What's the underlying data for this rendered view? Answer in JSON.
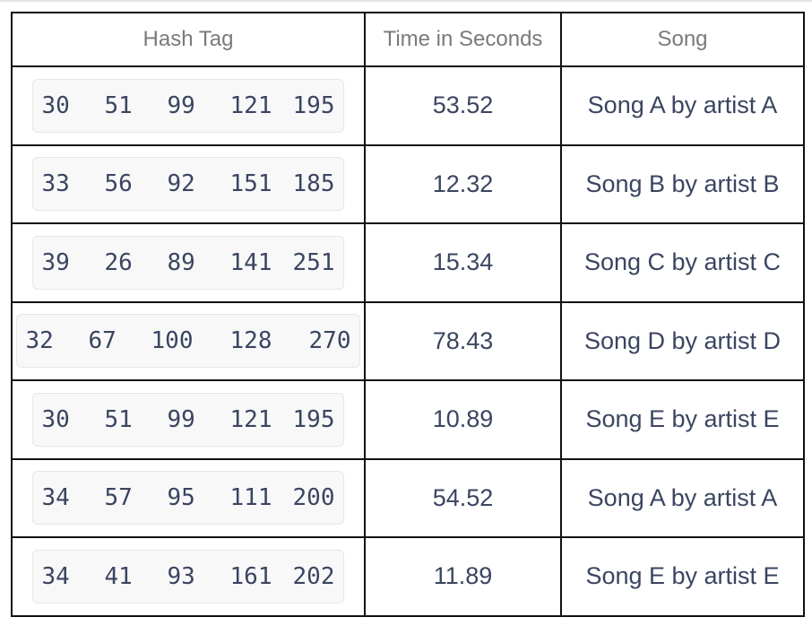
{
  "headers": [
    "Hash Tag",
    "Time in Seconds",
    "Song"
  ],
  "rows": [
    {
      "hash": [
        "30",
        "51",
        "99",
        "121",
        "195"
      ],
      "time": "53.52",
      "song": "Song A by artist A"
    },
    {
      "hash": [
        "33",
        "56",
        "92",
        "151",
        "185"
      ],
      "time": "12.32",
      "song": "Song B by artist B"
    },
    {
      "hash": [
        "39",
        "26",
        "89",
        "141",
        "251"
      ],
      "time": "15.34",
      "song": "Song C by artist C"
    },
    {
      "hash": [
        "32",
        "67",
        "100",
        "128",
        "270"
      ],
      "time": "78.43",
      "song": "Song D by artist D"
    },
    {
      "hash": [
        "30",
        "51",
        "99",
        "121",
        "195"
      ],
      "time": "10.89",
      "song": "Song E by artist E"
    },
    {
      "hash": [
        "34",
        "57",
        "95",
        "111",
        "200"
      ],
      "time": "54.52",
      "song": "Song A by artist A"
    },
    {
      "hash": [
        "34",
        "41",
        "93",
        "161",
        "202"
      ],
      "time": "11.89",
      "song": "Song E by artist E"
    }
  ]
}
